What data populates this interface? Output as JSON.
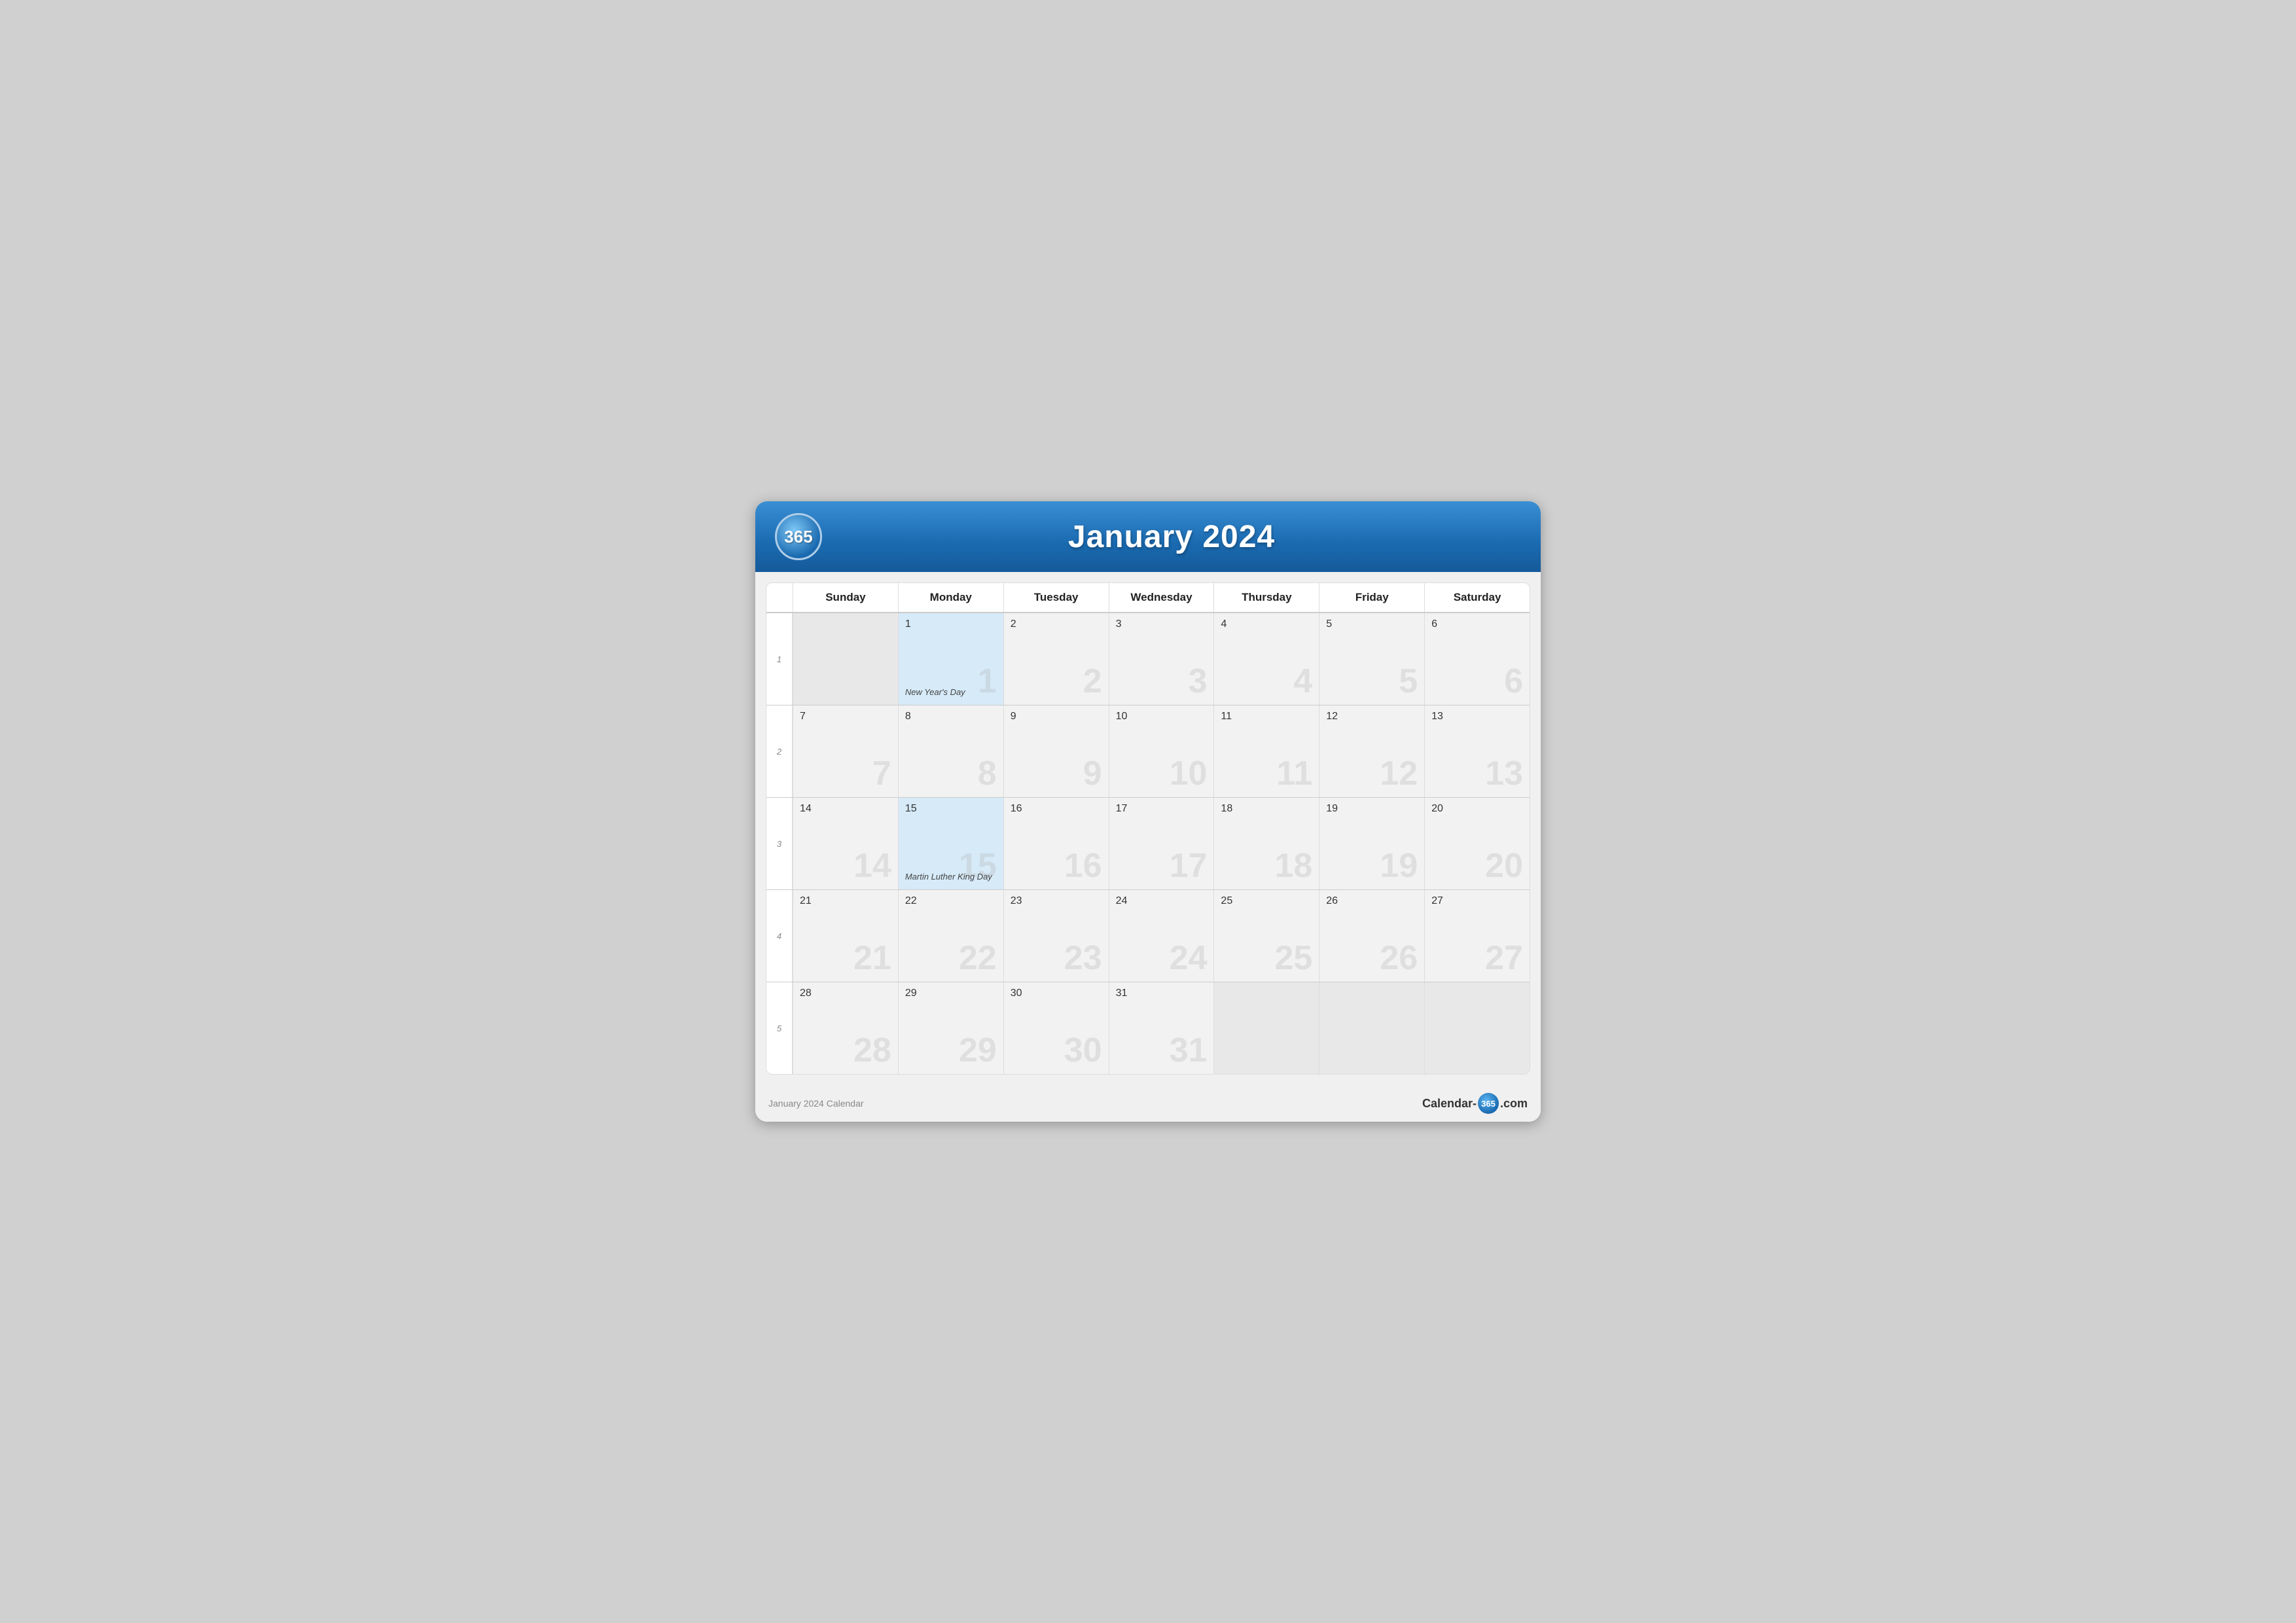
{
  "header": {
    "logo": "365",
    "title": "January 2024"
  },
  "days_of_week": [
    "Sunday",
    "Monday",
    "Tuesday",
    "Wednesday",
    "Thursday",
    "Friday",
    "Saturday"
  ],
  "weeks": [
    {
      "week_num": "1",
      "days": [
        {
          "date": "",
          "empty": true,
          "watermark": ""
        },
        {
          "date": "1",
          "highlight": true,
          "holiday": "New Year's Day",
          "watermark": "1"
        },
        {
          "date": "2",
          "watermark": "2"
        },
        {
          "date": "3",
          "watermark": "3"
        },
        {
          "date": "4",
          "watermark": "4"
        },
        {
          "date": "5",
          "watermark": "5"
        },
        {
          "date": "6",
          "watermark": "6"
        }
      ]
    },
    {
      "week_num": "2",
      "days": [
        {
          "date": "7",
          "watermark": "7"
        },
        {
          "date": "8",
          "watermark": "8"
        },
        {
          "date": "9",
          "watermark": "9"
        },
        {
          "date": "10",
          "watermark": "10"
        },
        {
          "date": "11",
          "watermark": "11"
        },
        {
          "date": "12",
          "watermark": "12"
        },
        {
          "date": "13",
          "watermark": "13"
        }
      ]
    },
    {
      "week_num": "3",
      "days": [
        {
          "date": "14",
          "watermark": "14"
        },
        {
          "date": "15",
          "highlight": true,
          "holiday": "Martin Luther King Day",
          "watermark": "15"
        },
        {
          "date": "16",
          "watermark": "16"
        },
        {
          "date": "17",
          "watermark": "17"
        },
        {
          "date": "18",
          "watermark": "18"
        },
        {
          "date": "19",
          "watermark": "19"
        },
        {
          "date": "20",
          "watermark": "20"
        }
      ]
    },
    {
      "week_num": "4",
      "days": [
        {
          "date": "21",
          "watermark": "21"
        },
        {
          "date": "22",
          "watermark": "22"
        },
        {
          "date": "23",
          "watermark": "23"
        },
        {
          "date": "24",
          "watermark": "24"
        },
        {
          "date": "25",
          "watermark": "25"
        },
        {
          "date": "26",
          "watermark": "26"
        },
        {
          "date": "27",
          "watermark": "27"
        }
      ]
    },
    {
      "week_num": "5",
      "days": [
        {
          "date": "28",
          "watermark": "28"
        },
        {
          "date": "29",
          "watermark": "29"
        },
        {
          "date": "30",
          "watermark": "30"
        },
        {
          "date": "31",
          "watermark": "31"
        },
        {
          "date": "",
          "empty": true,
          "watermark": ""
        },
        {
          "date": "",
          "empty": true,
          "watermark": ""
        },
        {
          "date": "",
          "empty": true,
          "watermark": ""
        }
      ]
    }
  ],
  "footer": {
    "left": "January 2024 Calendar",
    "right_prefix": "Calendar-",
    "right_badge": "365",
    "right_suffix": ".com"
  }
}
